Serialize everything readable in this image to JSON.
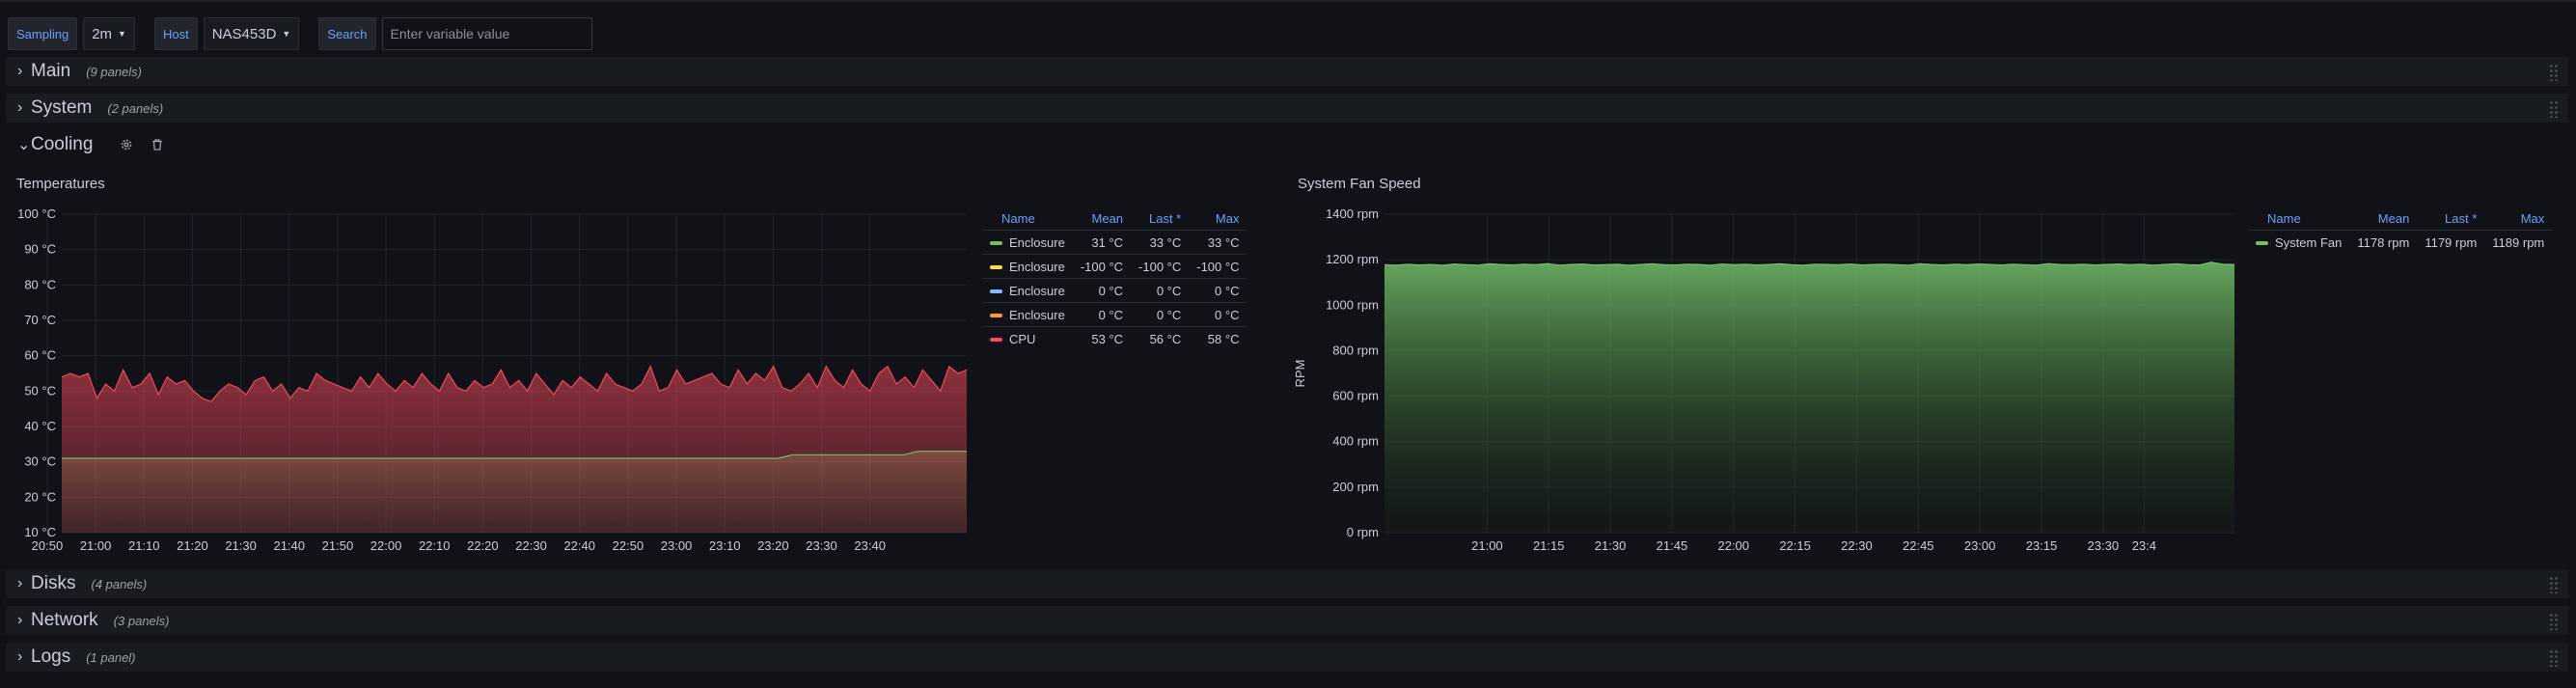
{
  "variables": {
    "sampling_label": "Sampling",
    "sampling_value": "2m",
    "host_label": "Host",
    "host_value": "NAS453D",
    "search_label": "Search",
    "search_placeholder": "Enter variable value"
  },
  "rows": {
    "main": {
      "title": "Main",
      "count": "(9 panels)",
      "collapsed": true
    },
    "system": {
      "title": "System",
      "count": "(2 panels)",
      "collapsed": true
    },
    "cooling": {
      "title": "Cooling",
      "collapsed": false
    },
    "disks": {
      "title": "Disks",
      "count": "(4 panels)",
      "collapsed": true
    },
    "network": {
      "title": "Network",
      "count": "(3 panels)",
      "collapsed": true
    },
    "logs": {
      "title": "Logs",
      "count": "(1 panel)",
      "collapsed": true
    }
  },
  "icons": {
    "row_collapsed": "chevron-right-icon",
    "row_expanded": "chevron-down-icon",
    "settings": "gear-icon",
    "delete": "trash-icon",
    "drag": "drag-handle-icon"
  },
  "temperatures": {
    "title": "Temperatures",
    "legend_headers": {
      "name": "Name",
      "mean": "Mean",
      "last": "Last *",
      "max": "Max"
    },
    "legend": [
      {
        "name": "Enclosure",
        "mean": "31 °C",
        "last": "33 °C",
        "max": "33 °C",
        "color": "#73bf69"
      },
      {
        "name": "Enclosure",
        "mean": "-100 °C",
        "last": "-100 °C",
        "max": "-100 °C",
        "color": "#fade2a"
      },
      {
        "name": "Enclosure",
        "mean": "0 °C",
        "last": "0 °C",
        "max": "0 °C",
        "color": "#8ab8ff"
      },
      {
        "name": "Enclosure",
        "mean": "0 °C",
        "last": "0 °C",
        "max": "0 °C",
        "color": "#ff9830"
      },
      {
        "name": "CPU",
        "mean": "53 °C",
        "last": "56 °C",
        "max": "58 °C",
        "color": "#f2495c"
      }
    ]
  },
  "fan": {
    "title": "System Fan Speed",
    "legend_headers": {
      "name": "Name",
      "mean": "Mean",
      "last": "Last *",
      "max": "Max"
    },
    "legend": [
      {
        "name": "System Fan",
        "mean": "1178 rpm",
        "last": "1179 rpm",
        "max": "1189 rpm",
        "color": "#73bf69"
      }
    ]
  },
  "chart_data": [
    {
      "type": "area",
      "title": "Temperatures",
      "ylim": [
        10,
        100
      ],
      "y_ticks": [
        "10 °C",
        "20 °C",
        "30 °C",
        "40 °C",
        "50 °C",
        "60 °C",
        "70 °C",
        "80 °C",
        "90 °C",
        "100 °C"
      ],
      "x_ticks": [
        "20:50",
        "21:00",
        "21:10",
        "21:20",
        "21:30",
        "21:40",
        "21:50",
        "22:00",
        "22:10",
        "22:20",
        "22:30",
        "22:40",
        "22:50",
        "23:00",
        "23:10",
        "23:20",
        "23:30",
        "23:40"
      ],
      "x_range_minutes": [
        -7,
        180
      ],
      "series": [
        {
          "name": "CPU",
          "color": "#f2495c",
          "values": [
            54,
            55,
            54,
            55,
            48,
            52,
            50,
            56,
            51,
            52,
            55,
            49,
            54,
            52,
            53,
            50,
            48,
            47,
            50,
            52,
            51,
            49,
            53,
            54,
            50,
            52,
            48,
            51,
            50,
            55,
            53,
            52,
            51,
            50,
            54,
            51,
            55,
            52,
            50,
            53,
            51,
            55,
            52,
            50,
            55,
            51,
            50,
            53,
            51,
            52,
            56,
            51,
            53,
            50,
            55,
            52,
            49,
            53,
            51,
            54,
            52,
            50,
            55,
            52,
            51,
            50,
            52,
            57,
            50,
            51,
            56,
            52,
            53,
            54,
            55,
            52,
            51,
            56,
            52,
            55,
            53,
            57,
            51,
            50,
            52,
            55,
            51,
            57,
            53,
            51,
            56,
            52,
            50,
            55,
            57,
            52,
            54,
            51,
            56,
            53,
            50,
            57,
            55,
            56
          ]
        },
        {
          "name": "Enclosure",
          "color": "#73bf69",
          "points": [
            [
              -7,
              31
            ],
            [
              141,
              31
            ],
            [
              144,
              32
            ],
            [
              167,
              32
            ],
            [
              170,
              33
            ],
            [
              180,
              33
            ]
          ]
        }
      ]
    },
    {
      "type": "area",
      "title": "System Fan Speed",
      "ylabel": "RPM",
      "ylim": [
        0,
        1400
      ],
      "y_ticks": [
        "0 rpm",
        "200 rpm",
        "400 rpm",
        "600 rpm",
        "800 rpm",
        "1000 rpm",
        "1200 rpm",
        "1400 rpm"
      ],
      "x_ticks": [
        "21:00",
        "21:15",
        "21:30",
        "21:45",
        "22:00",
        "22:15",
        "22:30",
        "22:45",
        "23:00",
        "23:15",
        "23:30",
        "23:4"
      ],
      "x_range_minutes": [
        -25,
        182
      ],
      "series": [
        {
          "name": "System Fan",
          "color": "#73bf69",
          "values": [
            1178,
            1176,
            1180,
            1177,
            1179,
            1175,
            1181,
            1178,
            1176,
            1182,
            1179,
            1177,
            1180,
            1178,
            1183,
            1176,
            1179,
            1181,
            1177,
            1178,
            1180,
            1176,
            1179,
            1182,
            1178,
            1177,
            1180,
            1179,
            1176,
            1181,
            1178,
            1180,
            1177,
            1179,
            1182,
            1178,
            1176,
            1180,
            1179,
            1178,
            1181,
            1177,
            1179,
            1180,
            1178,
            1176,
            1182,
            1179,
            1177,
            1180,
            1178,
            1181,
            1179,
            1177,
            1180,
            1178,
            1176,
            1183,
            1179,
            1178,
            1180,
            1177,
            1179,
            1181,
            1178,
            1180,
            1176,
            1179,
            1182,
            1178,
            1177,
            1189,
            1180,
            1179
          ]
        }
      ]
    }
  ]
}
